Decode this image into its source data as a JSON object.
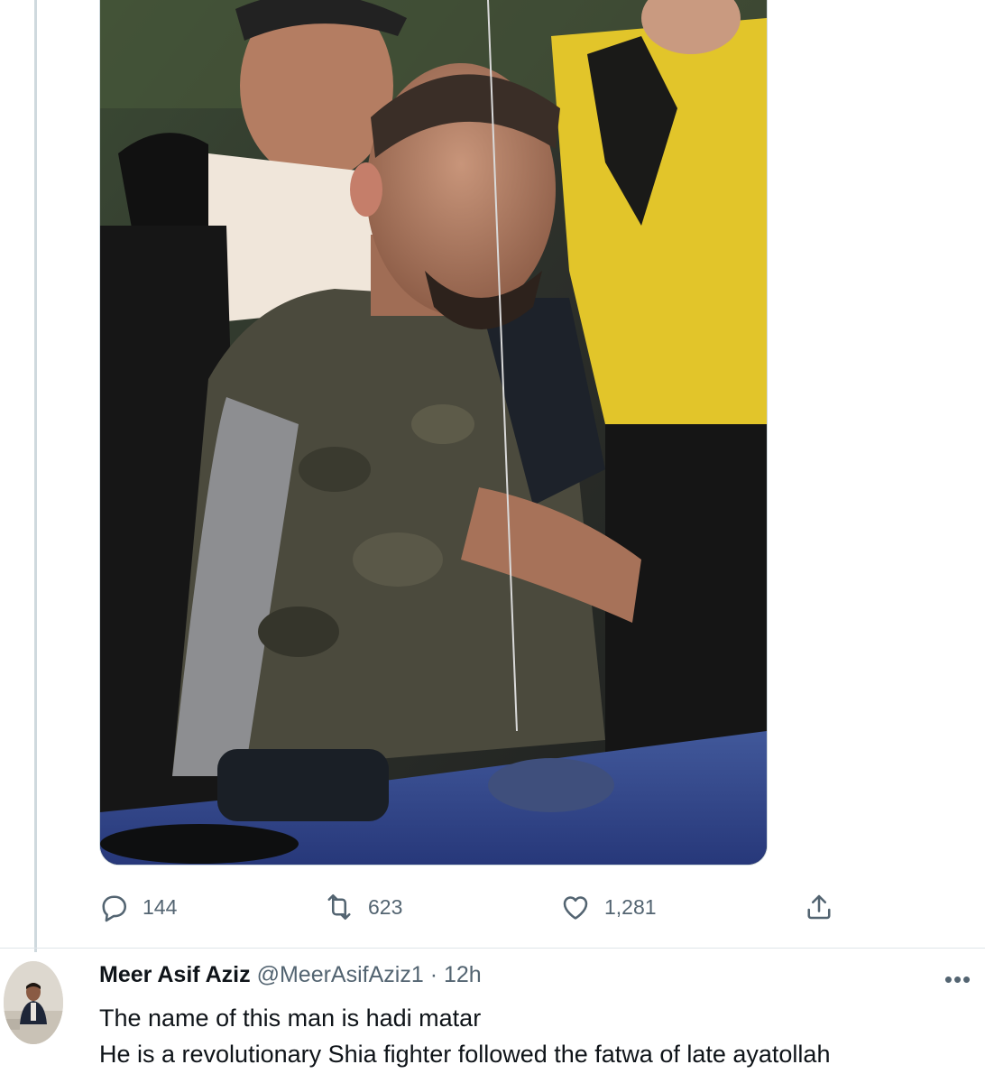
{
  "tweet": {
    "media": {
      "alt": "Photo of a man being restrained near a blue vehicle"
    },
    "actions": {
      "replies": "144",
      "retweets": "623",
      "likes": "1,281"
    }
  },
  "reply": {
    "author_name": "Meer Asif Aziz",
    "handle": "@MeerAsifAziz1",
    "separator": "·",
    "time": "12h",
    "text_lines": [
      "The name of this man is hadi matar",
      "He is a revolutionary Shia fighter followed the fatwa of late ayatollah"
    ]
  },
  "icons": {
    "reply": "speech-bubble-icon",
    "retweet": "retweet-arrows-icon",
    "like": "heart-icon",
    "share": "share-upload-icon",
    "more": "more-dots-icon"
  },
  "colors": {
    "icon_gray": "#536471",
    "text_dark": "#0f1419",
    "border": "#cfd9de"
  }
}
